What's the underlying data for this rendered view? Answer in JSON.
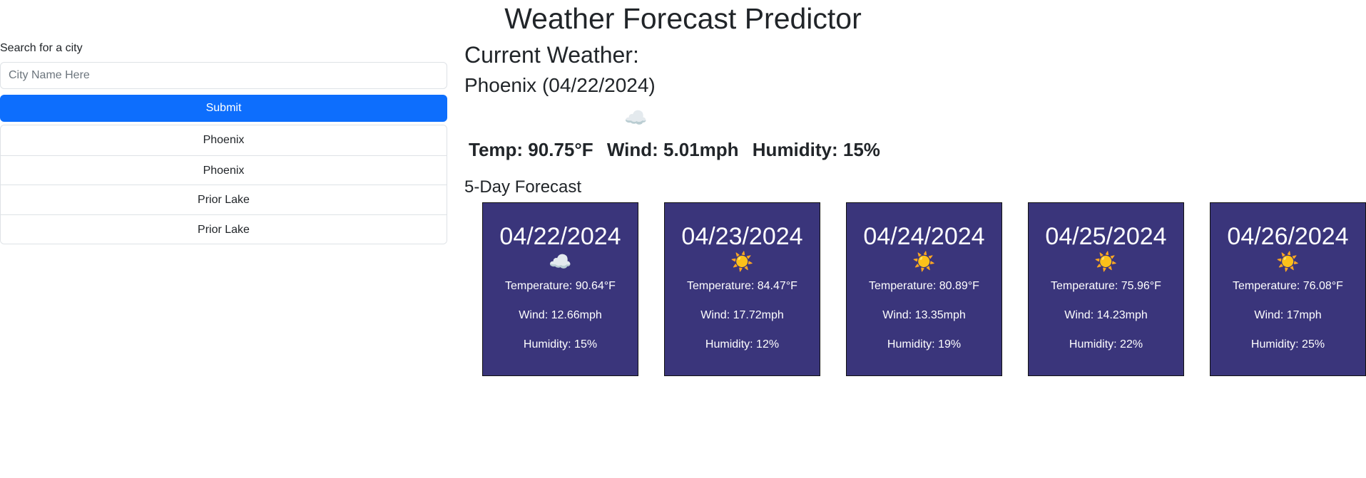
{
  "header": {
    "title": "Weather Forecast Predictor"
  },
  "search": {
    "label": "Search for a city",
    "placeholder": "City Name Here",
    "value": "",
    "submit_label": "Submit",
    "history": [
      "Phoenix",
      "Phoenix",
      "Prior Lake",
      "Prior Lake"
    ]
  },
  "current": {
    "heading": "Current Weather:",
    "city_date": "Phoenix (04/22/2024)",
    "icon": "cloud-icon",
    "icon_glyph": "☁️",
    "temp": "Temp: 90.75°F",
    "wind": "Wind: 5.01mph",
    "humidity": "Humidity: 15%"
  },
  "forecast": {
    "heading": "5-Day Forecast",
    "days": [
      {
        "date": "04/22/2024",
        "icon": "cloud-icon",
        "icon_glyph": "☁️",
        "temp": "Temperature: 90.64°F",
        "wind": "Wind: 12.66mph",
        "humidity": "Humidity: 15%"
      },
      {
        "date": "04/23/2024",
        "icon": "sun-icon",
        "icon_glyph": "☀️",
        "temp": "Temperature: 84.47°F",
        "wind": "Wind: 17.72mph",
        "humidity": "Humidity: 12%"
      },
      {
        "date": "04/24/2024",
        "icon": "sun-icon",
        "icon_glyph": "☀️",
        "temp": "Temperature: 80.89°F",
        "wind": "Wind: 13.35mph",
        "humidity": "Humidity: 19%"
      },
      {
        "date": "04/25/2024",
        "icon": "sun-icon",
        "icon_glyph": "☀️",
        "temp": "Temperature: 75.96°F",
        "wind": "Wind: 14.23mph",
        "humidity": "Humidity: 22%"
      },
      {
        "date": "04/26/2024",
        "icon": "sun-icon",
        "icon_glyph": "☀️",
        "temp": "Temperature: 76.08°F",
        "wind": "Wind: 17mph",
        "humidity": "Humidity: 25%"
      }
    ]
  },
  "colors": {
    "card_bg": "#3a357b",
    "submit_bg": "#0d6efd",
    "sun": "#f5b014",
    "cloud": "#e9eef3"
  }
}
